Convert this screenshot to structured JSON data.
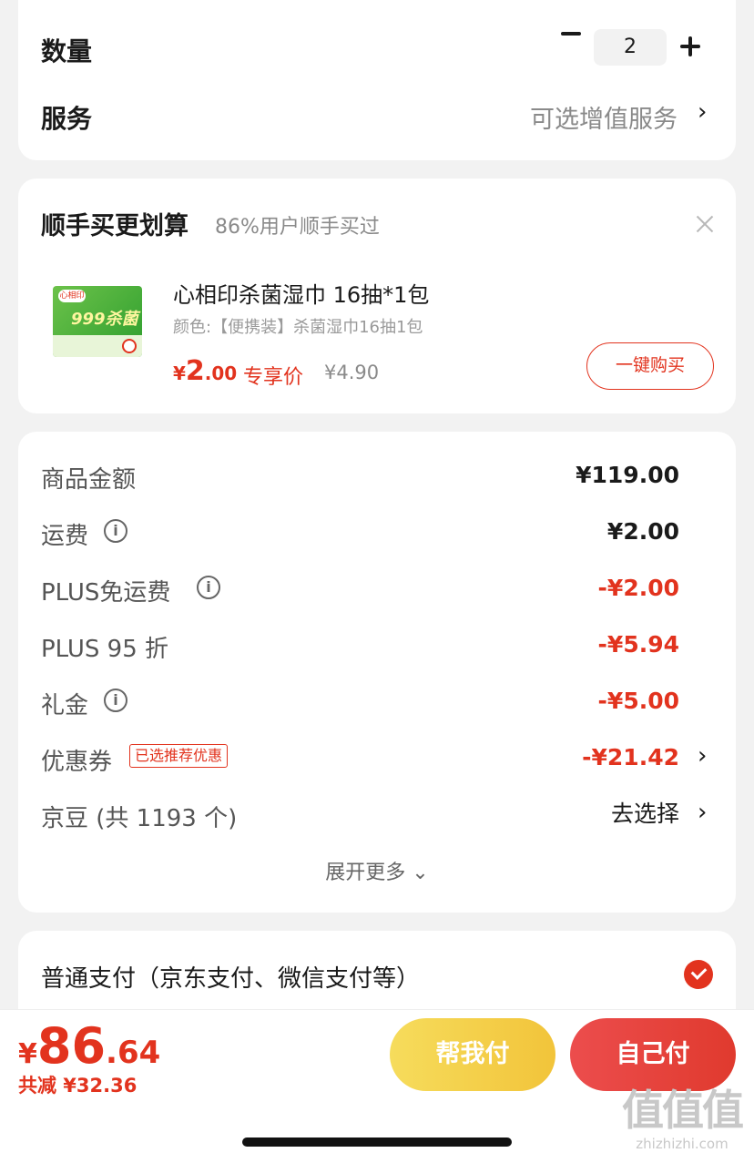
{
  "quantity": {
    "label": "数量",
    "value": "2"
  },
  "service": {
    "label": "服务",
    "value": "可选增值服务",
    "chevron": "›"
  },
  "addon": {
    "title": "顺手买更划算",
    "subtitle": "86%用户顺手买过",
    "product": {
      "image_text_logo": "心相印",
      "image_text_main": "999杀菌",
      "name": "心相印杀菌湿巾 16抽*1包",
      "spec": "颜色:【便携装】杀菌湿巾16抽1包",
      "price_symbol": "¥",
      "price_int": "2",
      "price_dec": ".00",
      "price_tag": "专享价",
      "original_price": "¥4.90",
      "buy_label": "一键购买"
    }
  },
  "amounts": {
    "rows": [
      {
        "label": "商品金额",
        "value": "¥119.00"
      },
      {
        "label": "运费",
        "value": "¥2.00"
      },
      {
        "label": "PLUS免运费",
        "value": "-¥2.00"
      },
      {
        "label": "PLUS 95 折",
        "value": "-¥5.94"
      },
      {
        "label": "礼金",
        "value": "-¥5.00"
      },
      {
        "label": "优惠券",
        "value": "-¥21.42",
        "tag": "已选推荐优惠"
      },
      {
        "label": "京豆 (共 1193 个)",
        "value": "去选择"
      }
    ],
    "info_glyph": "i",
    "expand_label": "展开更多 ⌄"
  },
  "payment": {
    "label": "普通支付（京东支付、微信支付等）"
  },
  "footer": {
    "total_symbol": "¥",
    "total_int": "86",
    "total_dec": ".64",
    "saved_text": "共减 ¥32.36",
    "help_pay_label": "帮我付",
    "self_pay_label": "自己付"
  },
  "watermark": {
    "logo": "值值值",
    "url": "zhizhizhi.com"
  },
  "colors": {
    "accent_red": "#e2331e",
    "help_button_yellow": "#f2c43a",
    "background": "#f2f2f2"
  }
}
